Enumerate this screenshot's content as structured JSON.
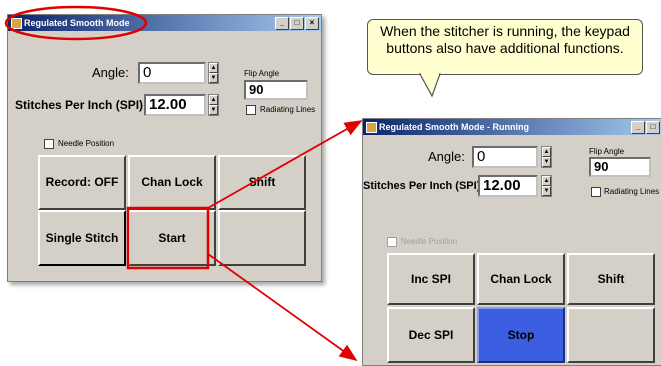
{
  "window1": {
    "title": "Regulated Smooth Mode",
    "angle_label": "Angle:",
    "angle_value": "0",
    "spi_label": "Stitches Per Inch (SPI)",
    "spi_value": "12.00",
    "flip_angle_label": "Flip Angle",
    "flip_angle_value": "90",
    "radiating_lines_label": "Radiating Lines",
    "needle_position_label": "Needle Position",
    "buttons": [
      "Record: OFF",
      "Chan Lock",
      "Shift",
      "Single Stitch",
      "Start",
      ""
    ]
  },
  "window2": {
    "title": "Regulated Smooth Mode - Running",
    "angle_label": "Angle:",
    "angle_value": "0",
    "spi_label": "Stitches Per Inch (SPI)",
    "spi_value": "12.00",
    "flip_angle_label": "Flip Angle",
    "flip_angle_value": "90",
    "radiating_lines_label": "Radiating Lines",
    "needle_position_label": "Needle Position",
    "buttons": [
      "Inc SPI",
      "Chan Lock",
      "Shift",
      "Dec SPI",
      "Stop",
      ""
    ]
  },
  "titlebar_buttons": [
    "_",
    "□",
    "×"
  ],
  "callout_text": "When the stitcher is running, the keypad buttons also have additional functions.",
  "colors": {
    "annotation_red": "#e00000",
    "stop_button": "#3b5fe0",
    "callout_bg": "#ffffcf"
  }
}
